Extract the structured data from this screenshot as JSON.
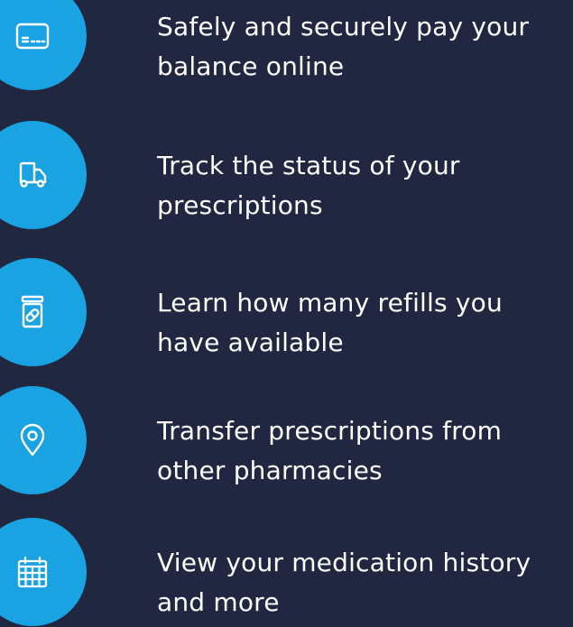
{
  "features": [
    {
      "icon": "credit-card-icon",
      "text": "Safely and securely pay your balance online"
    },
    {
      "icon": "delivery-truck-icon",
      "text": "Track the status of your prescriptions"
    },
    {
      "icon": "pill-bottle-icon",
      "text": "Learn how many refills you have available"
    },
    {
      "icon": "location-pin-icon",
      "text": "Transfer prescriptions from other pharmacies"
    },
    {
      "icon": "calendar-icon",
      "text": "View your medication history and more"
    }
  ],
  "colors": {
    "background": "#222741",
    "icon_circle": "#1aa3e3",
    "text": "#ffffff"
  }
}
